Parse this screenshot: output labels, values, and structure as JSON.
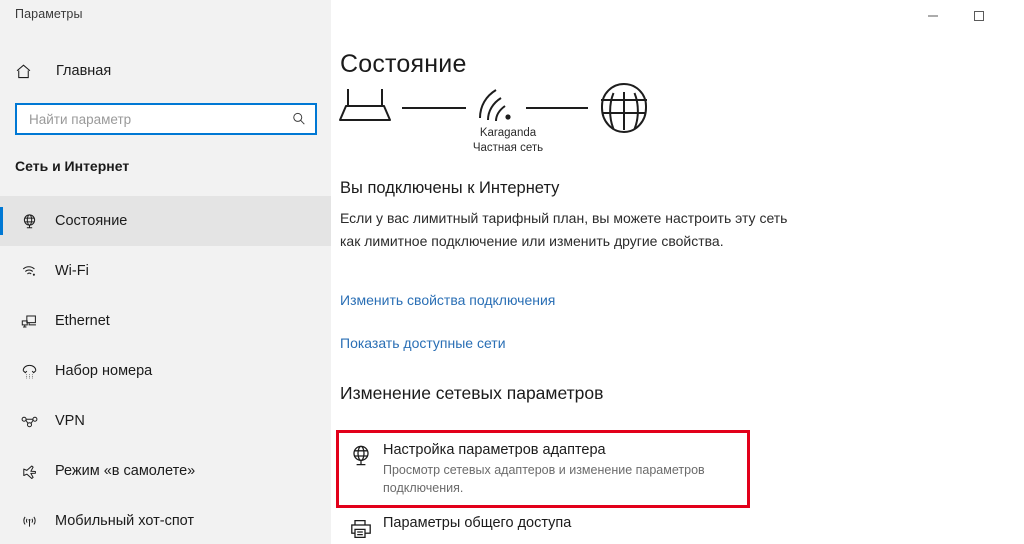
{
  "window": {
    "app_title": "Параметры",
    "minimize_glyph": "—",
    "maximize_glyph": "□"
  },
  "sidebar": {
    "home": {
      "label": "Главная",
      "icon": "home-icon"
    },
    "search": {
      "value": "",
      "placeholder": "Найти параметр",
      "icon": "search-icon"
    },
    "section_title": "Сеть и Интернет",
    "items": [
      {
        "label": "Состояние",
        "icon": "globe-monitor-icon",
        "selected": true
      },
      {
        "label": "Wi-Fi",
        "icon": "wifi-icon",
        "selected": false
      },
      {
        "label": "Ethernet",
        "icon": "ethernet-icon",
        "selected": false
      },
      {
        "label": "Набор номера",
        "icon": "dialup-phone-icon",
        "selected": false
      },
      {
        "label": "VPN",
        "icon": "vpn-icon",
        "selected": false
      },
      {
        "label": "Режим «в самолете»",
        "icon": "airplane-icon",
        "selected": false
      },
      {
        "label": "Мобильный хот-спот",
        "icon": "hotspot-icon",
        "selected": false
      }
    ]
  },
  "main": {
    "page_title": "Состояние",
    "diagram": {
      "device_icon": "router-icon",
      "signal_icon": "wifi-signal-icon",
      "internet_icon": "globe-icon",
      "network_name": "Karaganda",
      "network_type": "Частная сеть"
    },
    "status_heading": "Вы подключены к Интернету",
    "status_description": "Если у вас лимитный тарифный план, вы можете настроить эту сеть как лимитное подключение или изменить другие свойства.",
    "links": [
      {
        "label": "Изменить свойства подключения"
      },
      {
        "label": "Показать доступные сети"
      }
    ],
    "settings_heading": "Изменение сетевых параметров",
    "options": [
      {
        "title": "Настройка параметров адаптера",
        "subtitle": "Просмотр сетевых адаптеров и изменение параметров подключения.",
        "icon": "network-adapter-icon",
        "highlighted": true
      },
      {
        "title": "Параметры общего доступа",
        "subtitle": "",
        "icon": "printer-share-icon",
        "highlighted": false
      }
    ]
  },
  "colors": {
    "accent": "#0078d4",
    "link": "#2a6fb5",
    "highlight_box": "#e2001a",
    "sidebar_bg": "#f2f2f2",
    "main_bg": "#ffffff"
  }
}
